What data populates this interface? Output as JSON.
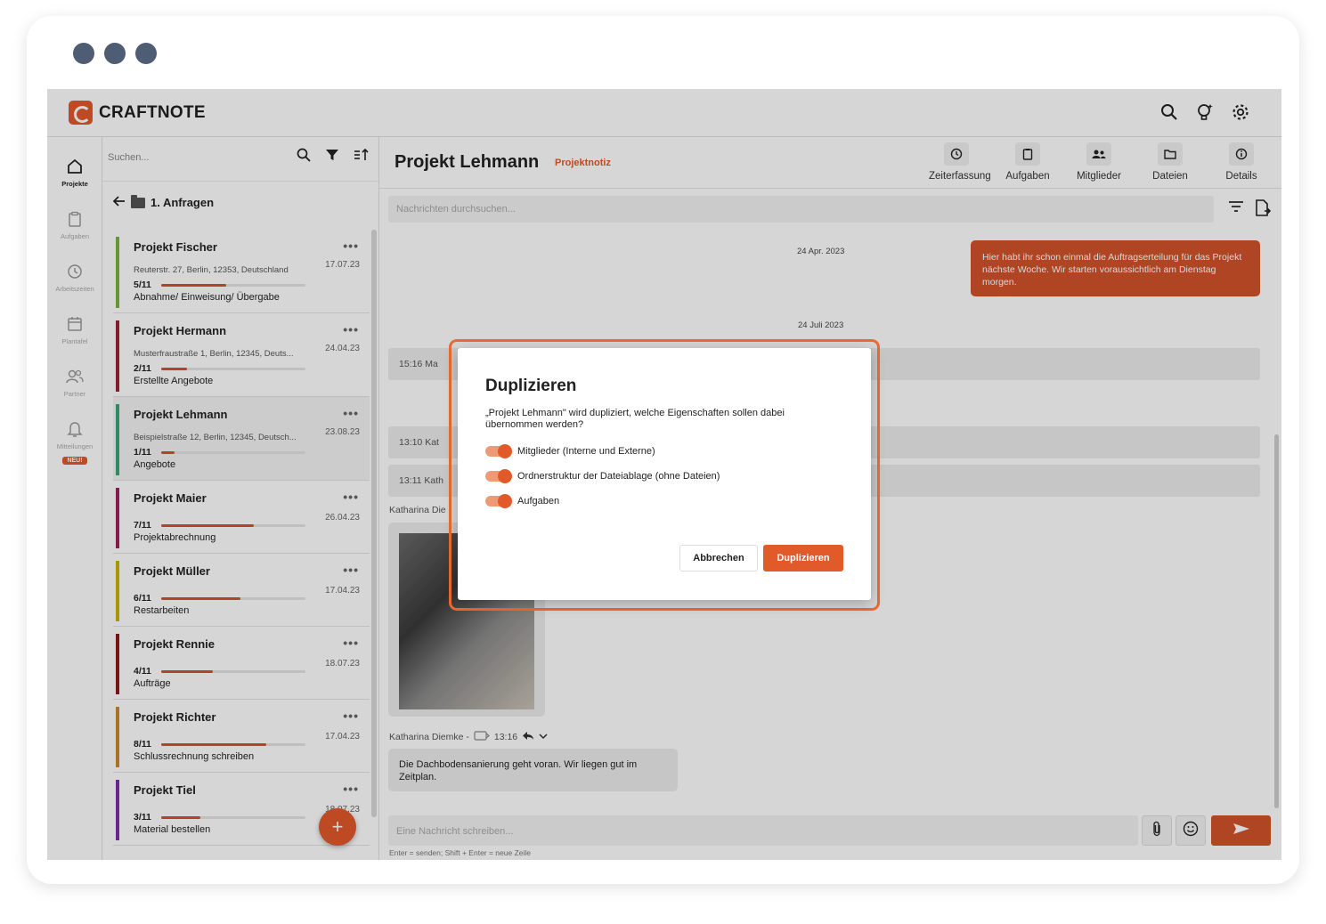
{
  "app": {
    "brand": "CRAFTNOTE",
    "accent_color": "#e2592a"
  },
  "topbar": {
    "icons": [
      "search-icon",
      "lightbulb-icon",
      "gear-icon"
    ]
  },
  "rail": {
    "items": [
      {
        "label": "Projekte",
        "icon": "home-icon"
      },
      {
        "label": "Aufgaben",
        "icon": "clipboard-icon"
      },
      {
        "label": "Arbeitszeiten",
        "icon": "clock-icon"
      },
      {
        "label": "Plantafel",
        "icon": "calendar-icon"
      },
      {
        "label": "Partner",
        "icon": "people-icon"
      },
      {
        "label": "Mitteilungen",
        "icon": "bell-icon",
        "badge": "NEU!"
      }
    ]
  },
  "project_list": {
    "search_placeholder": "Suchen...",
    "folder": "1. Anfragen",
    "projects": [
      {
        "title": "Projekt Fischer",
        "address": "Reuterstr. 27, Berlin, 12353, Deutschland",
        "date": "17.07.23",
        "count": "5/11",
        "progress": 0.45,
        "status": "Abnahme/ Einweisung/ Übergabe",
        "color": "#7cb342"
      },
      {
        "title": "Projekt Hermann",
        "address": "Musterfraustraße 1, Berlin, 12345, Deuts...",
        "date": "24.04.23",
        "count": "2/11",
        "progress": 0.18,
        "status": "Erstellte Angebote",
        "color": "#9b2335"
      },
      {
        "title": "Projekt Lehmann",
        "address": "Beispielstraße 12, Berlin, 12345, Deutsch...",
        "date": "23.08.23",
        "count": "1/11",
        "progress": 0.09,
        "status": "Angebote",
        "color": "#3aa876"
      },
      {
        "title": "Projekt Maier",
        "address": "",
        "date": "26.04.23",
        "count": "7/11",
        "progress": 0.64,
        "status": "Projektabrechnung",
        "color": "#a0215f"
      },
      {
        "title": "Projekt Müller",
        "address": "",
        "date": "17.04.23",
        "count": "6/11",
        "progress": 0.55,
        "status": "Restarbeiten",
        "color": "#c8b400"
      },
      {
        "title": "Projekt Rennie",
        "address": "",
        "date": "18.07.23",
        "count": "4/11",
        "progress": 0.36,
        "status": "Aufträge",
        "color": "#8b1a1a"
      },
      {
        "title": "Projekt Richter",
        "address": "",
        "date": "17.04.23",
        "count": "8/11",
        "progress": 0.73,
        "status": "Schlussrechnung schreiben",
        "color": "#c98a2e"
      },
      {
        "title": "Projekt Tiel",
        "address": "",
        "date": "18.07.23",
        "count": "3/11",
        "progress": 0.27,
        "status": "Material bestellen",
        "color": "#7b2fa8"
      }
    ],
    "dots": "•••",
    "fab_label": "+"
  },
  "chat": {
    "title": "Projekt Lehmann",
    "subtitle": "Projektnotiz",
    "actions": [
      {
        "label": "Zeiterfassung",
        "icon": "clock-icon"
      },
      {
        "label": "Aufgaben",
        "icon": "clipboard-icon"
      },
      {
        "label": "Mitglieder",
        "icon": "members-icon"
      },
      {
        "label": "Dateien",
        "icon": "folder-icon"
      },
      {
        "label": "Details",
        "icon": "info-icon"
      }
    ],
    "search_placeholder": "Nachrichten durchsuchen...",
    "date1": "24 Apr. 2023",
    "out_message": "Hier habt ihr schon einmal die Auftragserteilung für das Projekt nächste Woche. Wir starten voraussichtlich am Dienstag morgen.",
    "date2": "24 Juli 2023",
    "sys1": "15:16 Ma",
    "sys2": "13:10 Kat",
    "sys3": "13:11 Kath",
    "author1": "Katharina Die",
    "author2": "Katharina Diemke -",
    "author2_time": "13:16",
    "in_message": "Die Dachbodensanierung geht voran. Wir liegen gut im Zeitplan.",
    "compose_placeholder": "Eine Nachricht schreiben...",
    "hint": "Enter = senden; Shift + Enter = neue Zeile"
  },
  "modal": {
    "title": "Duplizieren",
    "description": "„Projekt Lehmann\" wird dupliziert, welche Eigenschaften sollen dabei übernommen werden?",
    "options": [
      {
        "label": "Mitglieder (Interne und Externe)",
        "enabled": true
      },
      {
        "label": "Ordnerstruktur der Dateiablage (ohne Dateien)",
        "enabled": true
      },
      {
        "label": "Aufgaben",
        "enabled": true
      }
    ],
    "cancel_label": "Abbrechen",
    "confirm_label": "Duplizieren"
  }
}
